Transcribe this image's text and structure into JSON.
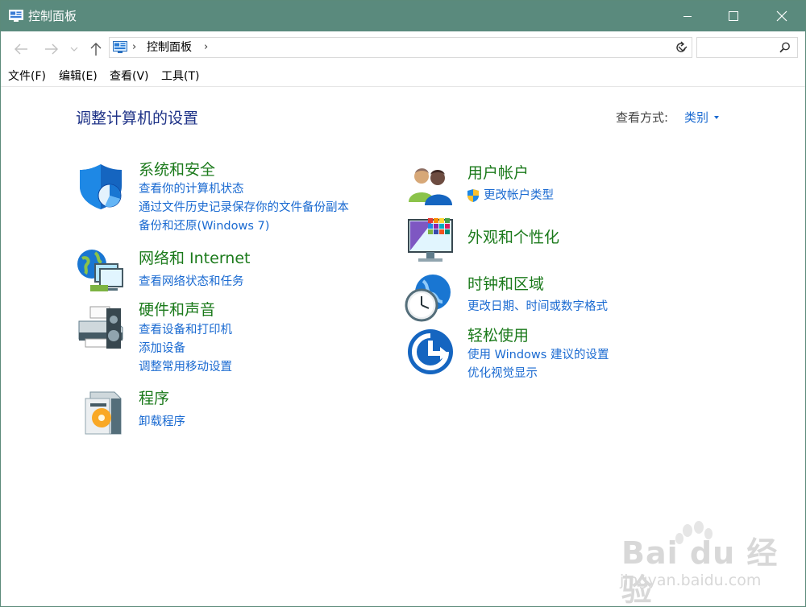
{
  "window": {
    "title": "控制面板"
  },
  "address": {
    "path": "控制面板",
    "search_placeholder": ""
  },
  "menu": {
    "file": "文件(F)",
    "edit": "编辑(E)",
    "view": "查看(V)",
    "tools": "工具(T)"
  },
  "header": {
    "title": "调整计算机的设置",
    "view_label": "查看方式:",
    "view_value": "类别"
  },
  "categories": {
    "system": {
      "title": "系统和安全",
      "links": [
        "查看你的计算机状态",
        "通过文件历史记录保存你的文件备份副本",
        "备份和还原(Windows 7)"
      ]
    },
    "network": {
      "title": "网络和 Internet",
      "links": [
        "查看网络状态和任务"
      ]
    },
    "hardware": {
      "title": "硬件和声音",
      "links": [
        "查看设备和打印机",
        "添加设备",
        "调整常用移动设置"
      ]
    },
    "programs": {
      "title": "程序",
      "links": [
        "卸载程序"
      ]
    },
    "users": {
      "title": "用户帐户",
      "links": [
        "更改帐户类型"
      ]
    },
    "appearance": {
      "title": "外观和个性化",
      "links": []
    },
    "clock": {
      "title": "时钟和区域",
      "links": [
        "更改日期、时间或数字格式"
      ]
    },
    "ease": {
      "title": "轻松使用",
      "links": [
        "使用 Windows 建议的设置",
        "优化视觉显示"
      ]
    }
  },
  "watermark": {
    "brand": "Bai du 经验",
    "url": "jingyan.baidu.com"
  },
  "colors": {
    "titlebar": "#5a8a7d",
    "category_title": "#1b7a1b",
    "link": "#1a6ad1",
    "page_title": "#1e3287"
  }
}
